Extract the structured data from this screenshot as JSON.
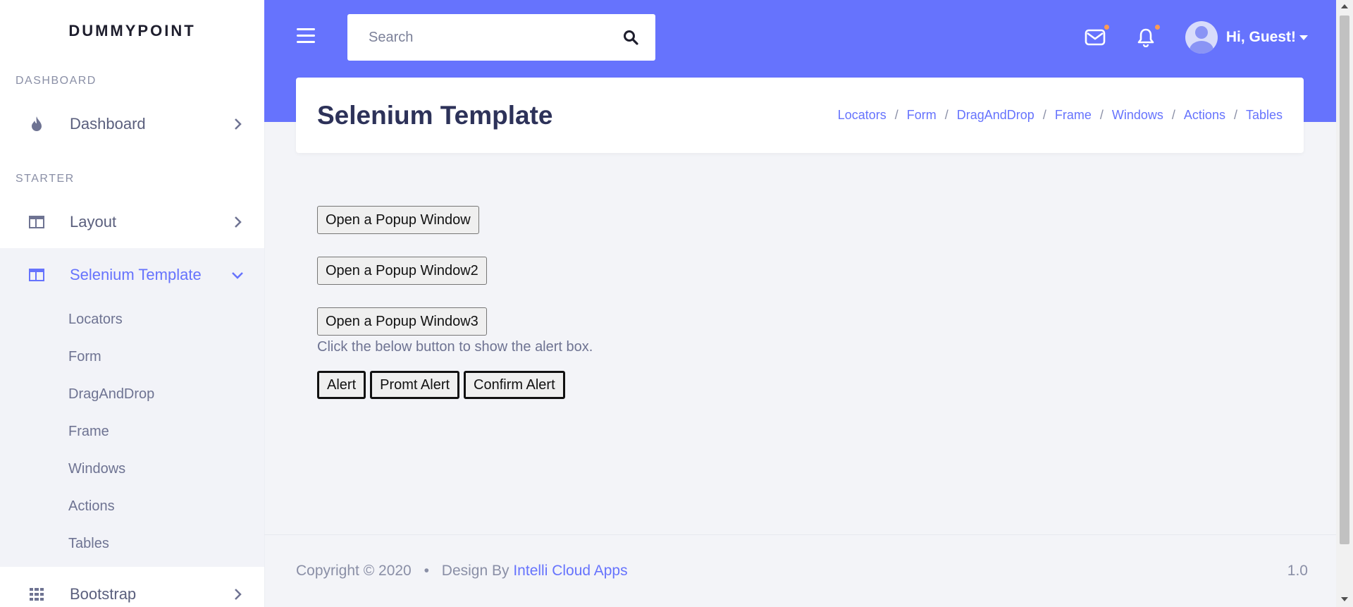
{
  "brand": "DUMMYPOINT",
  "sidebar": {
    "sections": {
      "dashboard_label": "DASHBOARD",
      "starter_label": "STARTER"
    },
    "items": {
      "dashboard": "Dashboard",
      "layout": "Layout",
      "selenium_template": "Selenium Template",
      "bootstrap": "Bootstrap"
    },
    "submenu": [
      "Locators",
      "Form",
      "DragAndDrop",
      "Frame",
      "Windows",
      "Actions",
      "Tables"
    ],
    "icons": {
      "dashboard": "flame-icon",
      "layout": "layout-icon",
      "selenium": "layout-icon",
      "bootstrap": "grid-icon"
    }
  },
  "header": {
    "search_placeholder": "Search",
    "user_greeting": "Hi, Guest!",
    "accent_color": "#6673fd",
    "notification_dot_color": "#ff9b52"
  },
  "page": {
    "title": "Selenium Template",
    "breadcrumb": [
      "Locators",
      "Form",
      "DragAndDrop",
      "Frame",
      "Windows",
      "Actions",
      "Tables"
    ],
    "breadcrumb_separator": "/"
  },
  "content": {
    "popup_buttons": [
      "Open a Popup Window",
      "Open a Popup Window2",
      "Open a Popup Window3"
    ],
    "info_text": "Click the below button to show the alert box.",
    "alert_buttons": [
      "Alert",
      "Promt Alert",
      "Confirm Alert"
    ]
  },
  "footer": {
    "copyright": "Copyright © 2020",
    "bullet": "•",
    "design_by": "Design By",
    "company": "Intelli Cloud Apps",
    "version": "1.0"
  }
}
